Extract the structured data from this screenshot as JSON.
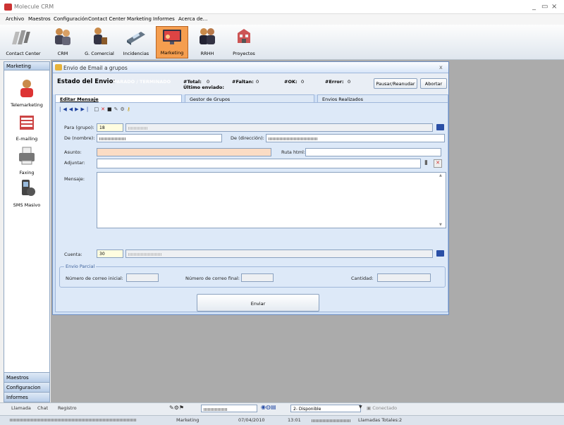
{
  "window": {
    "title": "Molecule CRM",
    "controls": [
      "_",
      "▭",
      "×"
    ]
  },
  "menu": [
    "Archivo",
    "Maestros",
    "Configuración",
    "Contact Center",
    "Marketing",
    "Informes",
    "Acerca de..."
  ],
  "toolbar": {
    "buttons": [
      {
        "label": "Contact Center",
        "icon": "contact-center-icon"
      },
      {
        "label": "CRM",
        "icon": "crm-icon"
      },
      {
        "label": "G. Comercial",
        "icon": "commercial-icon"
      },
      {
        "label": "Incidencias",
        "icon": "incidents-icon"
      },
      {
        "label": "Marketing",
        "icon": "marketing-icon",
        "active": true
      },
      {
        "label": "RRHH",
        "icon": "hr-icon"
      },
      {
        "label": "Proyectos",
        "icon": "projects-icon"
      }
    ]
  },
  "sidebar": {
    "header": "Marketing",
    "items": [
      {
        "label": "Telemarketing",
        "icon": "telemarketing-icon"
      },
      {
        "label": "E-mailing",
        "icon": "emailing-icon"
      },
      {
        "label": "Faxing",
        "icon": "fax-icon"
      },
      {
        "label": "SMS Masivo",
        "icon": "sms-icon"
      }
    ],
    "footer": [
      "Maestros",
      "Configuracion",
      "Informes"
    ]
  },
  "dialog": {
    "title": "Envio de Email a grupos",
    "close": "x",
    "status_label": "Estado del Envio:",
    "status_value": "PARADO / TERMINADO",
    "total_label": "#Total:",
    "total_value": "0",
    "ultimo_label": "Último enviado:",
    "faltan_label": "#Faltan:",
    "faltan_value": "0",
    "ok_label": "#OK:",
    "ok_value": "0",
    "error_label": "#Error:",
    "error_value": "0",
    "pause_btn": "Pausar/Reanudar",
    "abort_btn": "Abortar",
    "tabs": [
      "Editar Mensaje",
      "Gestor de Grupos",
      "Envios Realizados"
    ],
    "form": {
      "para_label": "Para (grupo):",
      "para_value": "18",
      "de_nombre_label": "De (nombre):",
      "de_dir_label": "De (dirección):",
      "asunto_label": "Asunto:",
      "ruta_label": "Ruta html:",
      "adjuntar_label": "Adjuntar:",
      "mensaje_label": "Mensaje:",
      "cuenta_label": "Cuenta:",
      "cuenta_value": "30",
      "envio_parcial_label": "Envio Parcial",
      "num_inicial_label": "Número de correo inicial:",
      "num_final_label": "Número de correo final:",
      "cantidad_label": "Cantidad:",
      "send_btn": "Enviar"
    }
  },
  "statusbar": {
    "tabs": [
      "Llamada",
      "Chat",
      "Registro"
    ],
    "disponible": "2- Disponible",
    "conectado": "Conectado",
    "module": "Marketing",
    "date": "07/04/2010",
    "time": "13:01",
    "llamadas": "Llamadas Totales:2"
  },
  "colors": {
    "active_tab": "#f59e4f",
    "dialog_bg": "#cfe0f6",
    "accent": "#2a4fa6"
  }
}
